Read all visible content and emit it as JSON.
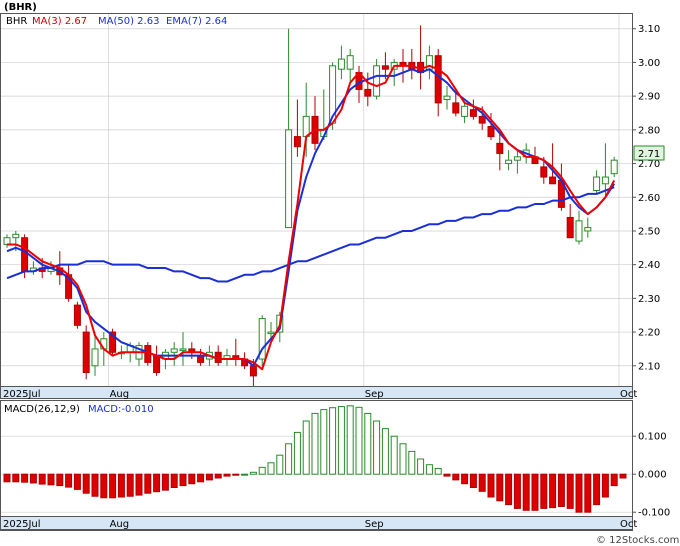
{
  "symbol": "(BHR)",
  "watermark": "© 12Stocks.com",
  "colors": {
    "up": "#2a8a2a",
    "down": "#dd0000",
    "ma3": "#ee0000",
    "ma50": "#1a2fd6",
    "ema7": "#1a2fd6",
    "axis_band": "#d6e6f5",
    "grid": "#cfcfcf",
    "label_bg": "#dff5df"
  },
  "price_legend": {
    "ticker": "BHR",
    "ma3": "MA(3)  2.67",
    "ma50": "MA(50)  2.63",
    "ema7": "EMA(7)  2.64"
  },
  "last_price_label": "2.71",
  "macd_legend": {
    "params": "MACD(26,12,9)",
    "value": "MACD:-0.010"
  },
  "month_labels": [
    "2025Jul",
    "Aug",
    "Sep",
    "Oct"
  ],
  "price_ticks": [
    "3.10",
    "3.00",
    "2.90",
    "2.80",
    "2.70",
    "2.60",
    "2.50",
    "2.40",
    "2.30",
    "2.20",
    "2.10"
  ],
  "macd_ticks": [
    "0.100",
    "0.000",
    "-0.100"
  ],
  "chart_data": {
    "type": "candlestick",
    "price_axis": [
      2.04,
      3.12
    ],
    "macd_axis": [
      -0.11,
      0.19
    ],
    "month_start_index": {
      "2025Jul": 0,
      "Aug": 12,
      "Sep": 41,
      "Oct": 70
    },
    "candles": [
      [
        2.46,
        2.49,
        2.45,
        2.48
      ],
      [
        2.48,
        2.5,
        2.44,
        2.49
      ],
      [
        2.48,
        2.49,
        2.36,
        2.38
      ],
      [
        2.38,
        2.41,
        2.37,
        2.39
      ],
      [
        2.39,
        2.42,
        2.36,
        2.38
      ],
      [
        2.38,
        2.41,
        2.37,
        2.39
      ],
      [
        2.39,
        2.44,
        2.34,
        2.37
      ],
      [
        2.37,
        2.4,
        2.29,
        2.3
      ],
      [
        2.28,
        2.29,
        2.21,
        2.22
      ],
      [
        2.2,
        2.22,
        2.06,
        2.08
      ],
      [
        2.1,
        2.2,
        2.07,
        2.15
      ],
      [
        2.15,
        2.2,
        2.1,
        2.18
      ],
      [
        2.2,
        2.21,
        2.13,
        2.14
      ],
      [
        2.14,
        2.16,
        2.12,
        2.14
      ],
      [
        2.14,
        2.17,
        2.11,
        2.16
      ],
      [
        2.12,
        2.17,
        2.1,
        2.16
      ],
      [
        2.16,
        2.17,
        2.1,
        2.11
      ],
      [
        2.13,
        2.16,
        2.07,
        2.08
      ],
      [
        2.12,
        2.15,
        2.09,
        2.14
      ],
      [
        2.14,
        2.17,
        2.1,
        2.15
      ],
      [
        2.15,
        2.2,
        2.1,
        2.15
      ],
      [
        2.15,
        2.17,
        2.12,
        2.14
      ],
      [
        2.13,
        2.15,
        2.1,
        2.11
      ],
      [
        2.12,
        2.16,
        2.1,
        2.14
      ],
      [
        2.14,
        2.16,
        2.1,
        2.11
      ],
      [
        2.12,
        2.15,
        2.1,
        2.13
      ],
      [
        2.13,
        2.18,
        2.1,
        2.12
      ],
      [
        2.12,
        2.14,
        2.09,
        2.1
      ],
      [
        2.1,
        2.12,
        2.04,
        2.07
      ],
      [
        2.12,
        2.25,
        2.1,
        2.24
      ],
      [
        2.2,
        2.23,
        2.18,
        2.2
      ],
      [
        2.2,
        2.26,
        2.17,
        2.25
      ],
      [
        2.51,
        3.1,
        2.51,
        2.8
      ],
      [
        2.78,
        2.89,
        2.72,
        2.75
      ],
      [
        2.78,
        2.94,
        2.72,
        2.84
      ],
      [
        2.84,
        2.9,
        2.74,
        2.76
      ],
      [
        2.78,
        2.92,
        2.77,
        2.8
      ],
      [
        2.82,
        3.0,
        2.8,
        2.99
      ],
      [
        2.98,
        3.05,
        2.95,
        3.01
      ],
      [
        2.98,
        3.04,
        2.94,
        3.02
      ],
      [
        2.97,
        2.99,
        2.88,
        2.92
      ],
      [
        2.92,
        2.97,
        2.87,
        2.9
      ],
      [
        2.9,
        3.01,
        2.89,
        2.99
      ],
      [
        2.99,
        3.03,
        2.95,
        2.98
      ],
      [
        2.98,
        3.01,
        2.93,
        3.0
      ],
      [
        3.0,
        3.04,
        2.94,
        2.99
      ],
      [
        3.0,
        3.04,
        2.95,
        2.98
      ],
      [
        3.0,
        3.11,
        2.92,
        2.97
      ],
      [
        2.98,
        3.05,
        2.95,
        3.02
      ],
      [
        3.02,
        3.04,
        2.84,
        2.88
      ],
      [
        2.89,
        2.93,
        2.86,
        2.9
      ],
      [
        2.88,
        2.91,
        2.84,
        2.85
      ],
      [
        2.84,
        2.88,
        2.82,
        2.87
      ],
      [
        2.86,
        2.89,
        2.83,
        2.84
      ],
      [
        2.84,
        2.87,
        2.8,
        2.82
      ],
      [
        2.81,
        2.85,
        2.77,
        2.78
      ],
      [
        2.76,
        2.8,
        2.68,
        2.73
      ],
      [
        2.7,
        2.74,
        2.68,
        2.71
      ],
      [
        2.71,
        2.74,
        2.67,
        2.72
      ],
      [
        2.72,
        2.76,
        2.7,
        2.74
      ],
      [
        2.72,
        2.75,
        2.7,
        2.7
      ],
      [
        2.69,
        2.72,
        2.64,
        2.66
      ],
      [
        2.66,
        2.76,
        2.64,
        2.64
      ],
      [
        2.65,
        2.7,
        2.56,
        2.57
      ],
      [
        2.54,
        2.58,
        2.48,
        2.48
      ],
      [
        2.47,
        2.56,
        2.46,
        2.53
      ],
      [
        2.5,
        2.54,
        2.48,
        2.51
      ],
      [
        2.62,
        2.68,
        2.61,
        2.66
      ],
      [
        2.64,
        2.76,
        2.6,
        2.66
      ],
      [
        2.67,
        2.72,
        2.66,
        2.71
      ]
    ],
    "ma3": [
      2.46,
      2.46,
      2.45,
      2.43,
      2.41,
      2.4,
      2.39,
      2.37,
      2.34,
      2.28,
      2.19,
      2.15,
      2.13,
      2.14,
      2.14,
      2.14,
      2.14,
      2.13,
      2.12,
      2.12,
      2.14,
      2.14,
      2.14,
      2.13,
      2.12,
      2.12,
      2.12,
      2.12,
      2.11,
      2.09,
      2.17,
      2.22,
      2.41,
      2.58,
      2.78,
      2.8,
      2.8,
      2.82,
      2.86,
      2.94,
      2.97,
      2.94,
      2.93,
      2.94,
      2.99,
      2.99,
      2.99,
      2.98,
      2.99,
      2.98,
      2.96,
      2.92,
      2.88,
      2.87,
      2.86,
      2.83,
      2.8,
      2.76,
      2.74,
      2.72,
      2.72,
      2.71,
      2.69,
      2.66,
      2.62,
      2.58,
      2.55,
      2.57,
      2.6,
      2.65
    ],
    "ma50": [
      2.36,
      2.37,
      2.38,
      2.38,
      2.39,
      2.39,
      2.4,
      2.4,
      2.4,
      2.41,
      2.41,
      2.41,
      2.4,
      2.4,
      2.4,
      2.4,
      2.39,
      2.39,
      2.39,
      2.38,
      2.38,
      2.37,
      2.36,
      2.36,
      2.35,
      2.35,
      2.36,
      2.37,
      2.37,
      2.38,
      2.38,
      2.39,
      2.4,
      2.41,
      2.41,
      2.42,
      2.43,
      2.44,
      2.45,
      2.46,
      2.46,
      2.47,
      2.48,
      2.48,
      2.49,
      2.5,
      2.5,
      2.51,
      2.52,
      2.52,
      2.53,
      2.53,
      2.54,
      2.54,
      2.55,
      2.55,
      2.56,
      2.56,
      2.57,
      2.57,
      2.58,
      2.58,
      2.59,
      2.59,
      2.6,
      2.6,
      2.61,
      2.61,
      2.62,
      2.63
    ],
    "ema7": [
      2.44,
      2.45,
      2.44,
      2.42,
      2.4,
      2.39,
      2.38,
      2.36,
      2.33,
      2.26,
      2.23,
      2.21,
      2.19,
      2.17,
      2.16,
      2.15,
      2.14,
      2.13,
      2.13,
      2.13,
      2.13,
      2.13,
      2.13,
      2.13,
      2.12,
      2.12,
      2.12,
      2.12,
      2.1,
      2.15,
      2.18,
      2.21,
      2.38,
      2.56,
      2.66,
      2.73,
      2.78,
      2.84,
      2.88,
      2.92,
      2.94,
      2.95,
      2.96,
      2.96,
      2.96,
      2.97,
      2.98,
      2.97,
      2.98,
      2.96,
      2.94,
      2.91,
      2.89,
      2.87,
      2.85,
      2.82,
      2.79,
      2.76,
      2.74,
      2.73,
      2.72,
      2.71,
      2.68,
      2.65,
      2.6,
      2.57,
      2.55,
      2.57,
      2.6,
      2.64
    ],
    "macd": [
      -0.02,
      -0.02,
      -0.021,
      -0.023,
      -0.026,
      -0.028,
      -0.03,
      -0.034,
      -0.04,
      -0.05,
      -0.058,
      -0.062,
      -0.062,
      -0.06,
      -0.058,
      -0.055,
      -0.05,
      -0.046,
      -0.042,
      -0.035,
      -0.03,
      -0.025,
      -0.02,
      -0.015,
      -0.01,
      -0.005,
      -0.002,
      0.0,
      0.005,
      0.018,
      0.03,
      0.05,
      0.08,
      0.11,
      0.14,
      0.16,
      0.17,
      0.175,
      0.178,
      0.18,
      0.176,
      0.16,
      0.14,
      0.12,
      0.1,
      0.08,
      0.06,
      0.04,
      0.025,
      0.015,
      -0.005,
      -0.015,
      -0.025,
      -0.035,
      -0.045,
      -0.06,
      -0.07,
      -0.08,
      -0.09,
      -0.095,
      -0.095,
      -0.09,
      -0.088,
      -0.085,
      -0.09,
      -0.1,
      -0.1,
      -0.08,
      -0.06,
      -0.03,
      -0.01
    ]
  }
}
